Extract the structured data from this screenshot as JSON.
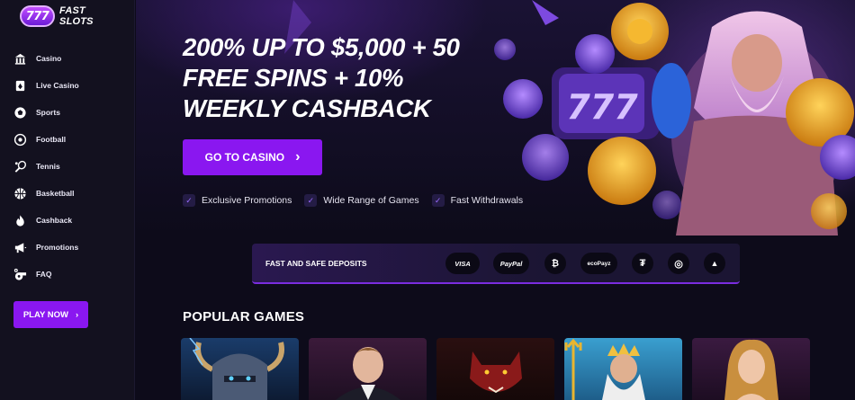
{
  "brand": {
    "badge": "777",
    "name": "FAST SLOTS"
  },
  "sidebar": {
    "items": [
      {
        "label": "Casino",
        "icon": "casino-icon"
      },
      {
        "label": "Live Casino",
        "icon": "card-icon"
      },
      {
        "label": "Sports",
        "icon": "ball-icon"
      },
      {
        "label": "Football",
        "icon": "football-icon"
      },
      {
        "label": "Tennis",
        "icon": "tennis-icon"
      },
      {
        "label": "Basketball",
        "icon": "basketball-icon"
      },
      {
        "label": "Cashback",
        "icon": "fire-icon"
      },
      {
        "label": "Promotions",
        "icon": "megaphone-icon"
      },
      {
        "label": "FAQ",
        "icon": "whistle-icon"
      }
    ],
    "play_now": "PLAY NOW"
  },
  "hero": {
    "title_lines": [
      "200% UP TO $5,000 + 50",
      "FREE SPINS + 10%",
      "WEEKLY CASHBACK"
    ],
    "cta": "GO TO CASINO",
    "features": [
      "Exclusive Promotions",
      "Wide Range of Games",
      "Fast Withdrawals"
    ],
    "slot_reel": "777"
  },
  "deposits": {
    "label": "FAST AND SAFE DEPOSITS",
    "methods": [
      "VISA",
      "PayPal",
      "₿",
      "ecoPayz",
      "₮",
      "◎",
      "▲"
    ]
  },
  "popular": {
    "title": "POPULAR GAMES",
    "games": [
      "viking-game",
      "dealer-game",
      "wolf-game",
      "poseidon-game",
      "lady-game"
    ]
  },
  "colors": {
    "accent": "#8a17f0",
    "background": "#0d0b1a",
    "sidebar": "#13111f"
  }
}
